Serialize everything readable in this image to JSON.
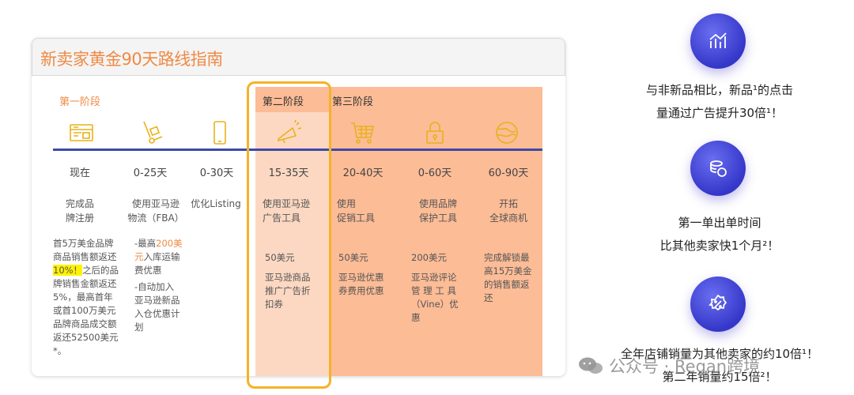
{
  "card": {
    "title": "新卖家黄金90天路线指南",
    "stages": [
      "第一阶段",
      "第二阶段",
      "第三阶段"
    ],
    "columns": [
      {
        "time": "现在",
        "action": [
          "完成品",
          "牌注册"
        ],
        "icon": "storefront-icon"
      },
      {
        "time": "0-25天",
        "action": [
          "使用亚马逊",
          "物流（FBA）"
        ],
        "icon": "hand-truck-icon"
      },
      {
        "time": "0-30天",
        "action": [
          "优化Listing"
        ],
        "icon": "phone-icon"
      },
      {
        "time": "15-35天",
        "action": [
          "使用亚马逊",
          "广告工具"
        ],
        "icon": "megaphone-icon"
      },
      {
        "time": "20-40天",
        "action": [
          "使用",
          "促销工具"
        ],
        "icon": "shopping-cart-icon"
      },
      {
        "time": "0-60天",
        "action": [
          "使用品牌",
          "保护工具"
        ],
        "icon": "lock-icon"
      },
      {
        "time": "60-90天",
        "action": [
          "开拓",
          "全球商机"
        ],
        "icon": "globe-icon"
      }
    ],
    "benefits": {
      "c1": {
        "pre": [
          "首5万美金品牌",
          "商品销售额返还"
        ],
        "highlight": "10%！",
        "mid": "之后的品",
        "post": [
          "牌销售金额返还",
          "5%，最高首年",
          "或首100万美元",
          "品牌商品成交额",
          "返还52500美元",
          "*。"
        ]
      },
      "c2": {
        "p1_pre": "-最高",
        "p1_orange": "200美",
        "p1_orange2": "元",
        "p1_mid": "入库运输",
        "p1_end": "费优惠",
        "p2": [
          "-自动加入",
          "亚马逊新品",
          "入仓优惠计",
          "划"
        ]
      },
      "c4": {
        "amount": "50美元",
        "lines": [
          "亚马逊商品",
          "推广广告折",
          "扣券"
        ]
      },
      "c5": {
        "amount": "50美元",
        "lines": [
          "亚马逊优惠",
          "券费用优惠"
        ]
      },
      "c6": {
        "amount": "200美元",
        "lines": [
          "亚马逊评论",
          "管 理 工 具",
          "（Vine）优",
          "惠"
        ]
      },
      "c7": {
        "lines": [
          "完成解锁最",
          "高15万美金",
          "的销售额返",
          "还"
        ]
      }
    }
  },
  "right": {
    "items": [
      {
        "icon": "growth-chart-icon",
        "lines": [
          "与非新品相比，新品¹的点击",
          "量通过广告提升30倍¹！"
        ]
      },
      {
        "icon": "coins-icon",
        "lines": [
          "第一单出单时间",
          "比其他卖家快1个月²！"
        ]
      },
      {
        "icon": "discount-icon",
        "lines": [
          "全年店铺销量为其他卖家的约10倍¹！",
          "第二年销量约15倍²！"
        ]
      }
    ]
  },
  "watermark": {
    "text": "公众号 · Regan跨境"
  },
  "colors": {
    "accent_orange": "#ef8a45",
    "frame_gold": "#f5b229",
    "timeline_blue": "#3c4aa8",
    "circle_purple": "#4a4de0"
  }
}
